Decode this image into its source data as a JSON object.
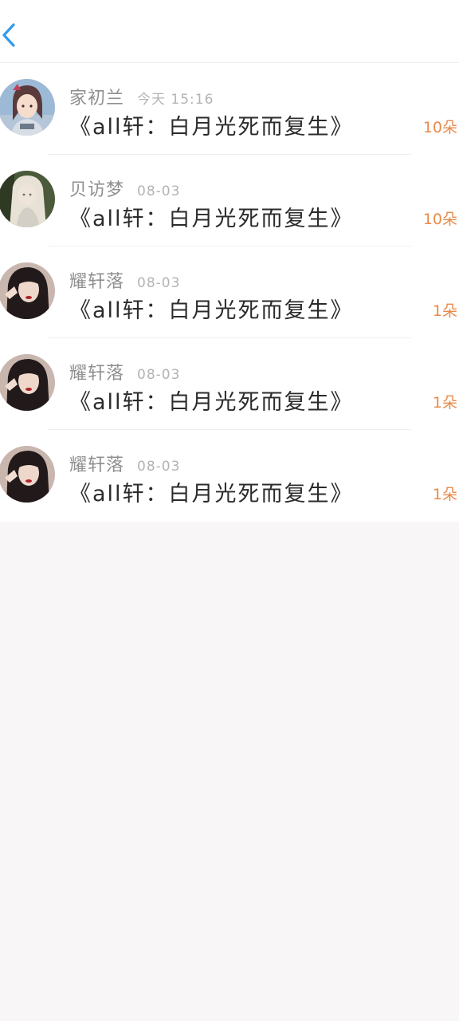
{
  "header": {
    "back_icon": "chevron-left-icon",
    "accent_color": "#2e9bf0"
  },
  "messages": [
    {
      "name": "家初兰",
      "date": "今天 15:16",
      "title": "《all轩：白月光死而复生》",
      "count": "10朵",
      "avatar": "girl-illustration-avatar"
    },
    {
      "name": "贝访梦",
      "date": "08-03",
      "title": "《all轩：白月光死而复生》",
      "count": "10朵",
      "avatar": "blonde-girl-photo-avatar"
    },
    {
      "name": "耀轩落",
      "date": "08-03",
      "title": "《all轩：白月光死而复生》",
      "count": "1朵",
      "avatar": "dark-hair-girl-photo-avatar"
    },
    {
      "name": "耀轩落",
      "date": "08-03",
      "title": "《all轩：白月光死而复生》",
      "count": "1朵",
      "avatar": "dark-hair-girl-photo-avatar"
    },
    {
      "name": "耀轩落",
      "date": "08-03",
      "title": "《all轩：白月光死而复生》",
      "count": "1朵",
      "avatar": "dark-hair-girl-photo-avatar"
    }
  ],
  "colors": {
    "count": "#e98a4a",
    "name": "#8f8f8f",
    "date": "#b3b3b3",
    "title": "#2b2b2b"
  }
}
